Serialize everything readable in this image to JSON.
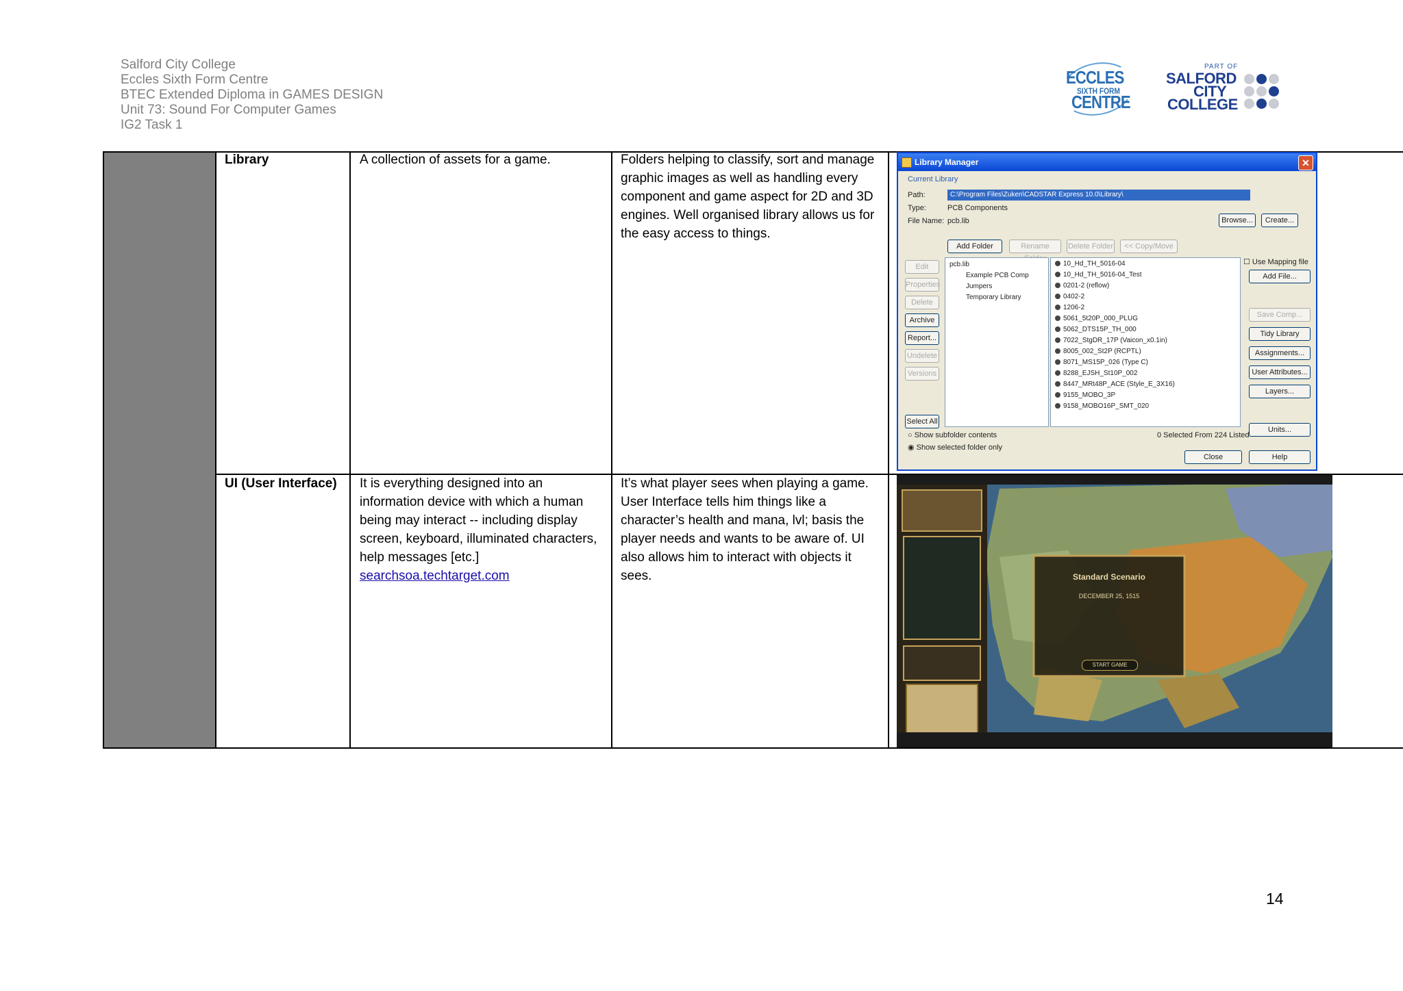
{
  "header": {
    "lines": [
      "Salford City College",
      "Eccles Sixth Form Centre",
      "BTEC Extended Diploma  in GAMES DESIGN",
      "Unit 73: Sound For Computer Games",
      "IG2 Task 1"
    ]
  },
  "logos": {
    "eccles": {
      "line1": "ECCLES",
      "line2": "SIXTH FORM",
      "line3": "CENTRE"
    },
    "salford": {
      "part_of": "PART OF",
      "word1": "SALFORD",
      "word2": "CITY",
      "word3": "COLLEGE"
    }
  },
  "rows": [
    {
      "term": "Library",
      "definition": "A collection of assets for a game.",
      "explanation": "Folders helping to classify, sort and manage graphic images as well as handling every component and game aspect for 2D and 3D engines. Well organised library allows us for the easy access to things."
    },
    {
      "term": "UI (User Interface)",
      "definition": "It is everything designed into an information device with which a human being may interact -- including display screen, keyboard, illuminated characters, help messages [etc.]",
      "link": "searchsoa.techtarget.com",
      "explanation": "It’s what player sees when playing a game. User Interface tells him things like a character’s health and mana, lvl; basis the player needs and wants to be aware of. UI also allows him to interact with objects it sees."
    }
  ],
  "library_manager": {
    "title": "Library Manager",
    "group_label": "Current Library",
    "path_label": "Path:",
    "path_value": "C:\\Program Files\\Zuken\\CADSTAR Express 10.0\\Library\\",
    "type_label": "Type:",
    "type_value": "PCB Components",
    "file_label": "File Name:",
    "file_value": "pcb.lib",
    "browse": "Browse...",
    "create": "Create...",
    "add_folder": "Add Folder",
    "rename_folder": "Rename Folder",
    "delete_folder": "Delete Folder",
    "copy_move": "<< Copy/Move",
    "left_buttons": [
      "Edit",
      "Properties",
      "Delete",
      "Archive",
      "Report...",
      "Undelete",
      "Versions",
      "Select All"
    ],
    "tree": [
      "pcb.lib",
      "Example PCB Comp",
      "Jumpers",
      "Temporary Library"
    ],
    "items": [
      "10_Hd_TH_5016-04",
      "10_Hd_TH_5016-04_Test",
      "0201-2 (reflow)",
      "0402-2",
      "1206-2",
      "5061_5t20P_000_PLUG",
      "5062_DTS15P_TH_000",
      "7022_StgDR_17P (Vaicon_x0.1in)",
      "8005_002_St2P (RCPTL)",
      "8071_MS15P_026 (Type C)",
      "8288_EJSH_St10P_002",
      "8447_MRt48P_ACE (Style_E_3X16)",
      "9155_MOBO_3P",
      "9158_MOBO16P_SMT_020"
    ],
    "use_mapping": "Use Mapping file",
    "right_buttons": [
      "Add File...",
      "Save Comp...",
      "Tidy Library",
      "Assignments...",
      "User Attributes...",
      "Layers...",
      "Units..."
    ],
    "radio1": "Show subfolder contents",
    "radio2": "Show selected folder only",
    "status": "0 Selected From 224 Listed",
    "close": "Close",
    "help": "Help"
  },
  "game_ui": {
    "dialog_title": "Standard Scenario",
    "dialog_date": "DECEMBER 25, 1515",
    "start_button": "START GAME"
  },
  "page_number": "14",
  "colors": {
    "header_text": "#7f7f7f",
    "grey_column": "#808080",
    "link": "#1a0dab"
  }
}
